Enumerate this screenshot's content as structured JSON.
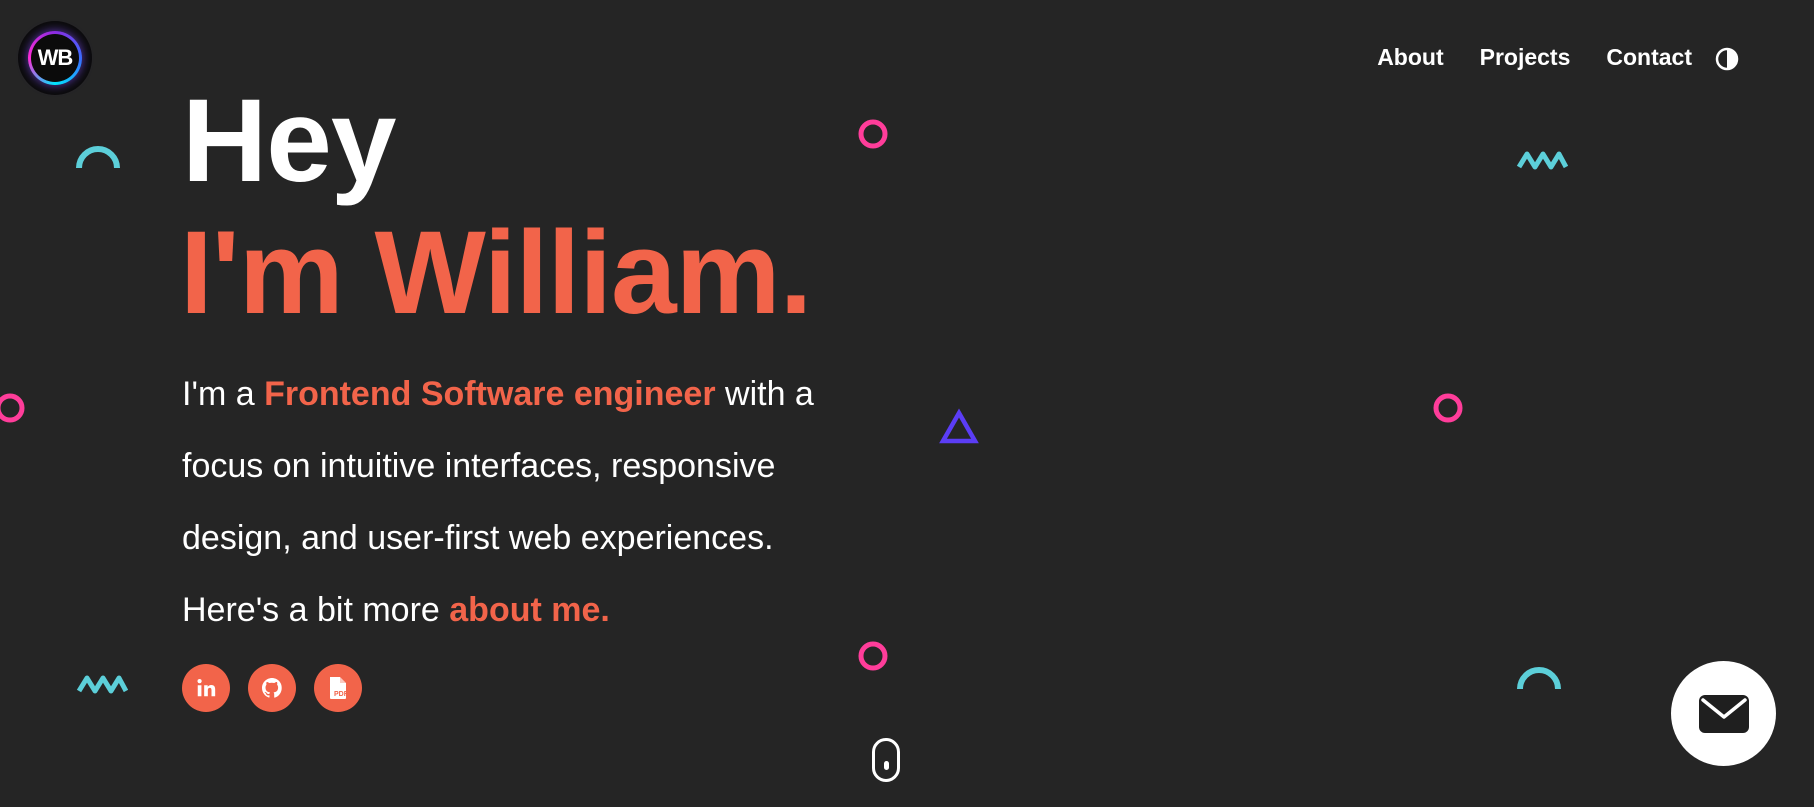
{
  "header": {
    "logo_text": "WB",
    "nav": [
      {
        "label": "About"
      },
      {
        "label": "Projects"
      },
      {
        "label": "Contact"
      }
    ],
    "theme_toggle_icon": "half-circle-contrast-icon"
  },
  "hero": {
    "greeting": "Hey",
    "name_line": "I'm William.",
    "intro_prefix": "I'm a ",
    "intro_role": "Frontend Software engineer",
    "intro_rest": " with a focus on intuitive interfaces, responsive design, and user-first web experiences.",
    "more_prefix": "Here's a bit more ",
    "more_link": "about me."
  },
  "socials": [
    {
      "icon": "linkedin-icon",
      "label": "in"
    },
    {
      "icon": "github-icon"
    },
    {
      "icon": "pdf-resume-icon",
      "label": "PDF"
    }
  ],
  "floating": {
    "scroll_icon": "mouse-scroll-icon",
    "mail_icon": "mail-icon"
  },
  "colors": {
    "background": "#252525",
    "accent": "#f2644a",
    "pink": "#ff3d9a",
    "cyan": "#5ccfd9",
    "violet": "#5b3df5",
    "text": "#ffffff"
  }
}
